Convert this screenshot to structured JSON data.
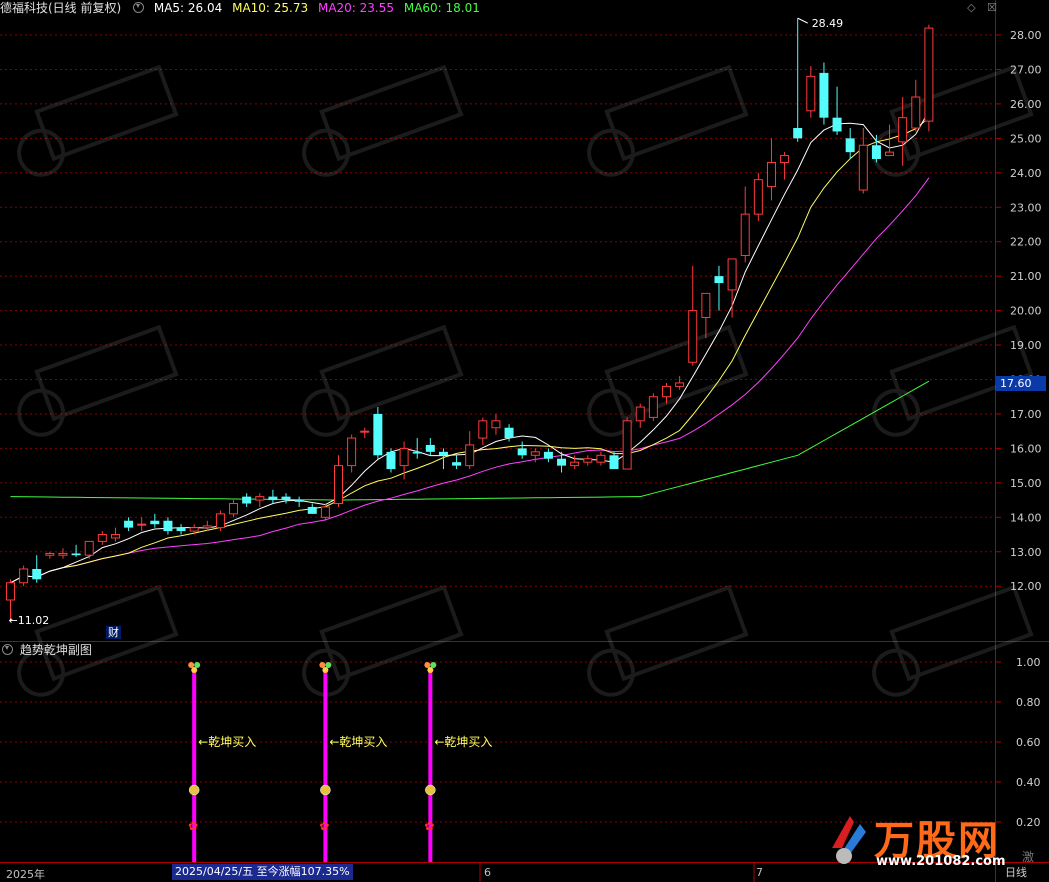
{
  "header": {
    "stock_name": "德福科技(日线 前复权)",
    "ma5_label": "MA5: 26.04",
    "ma10_label": "MA10: 25.73",
    "ma20_label": "MA20: 23.55",
    "ma60_label": "MA60: 18.01"
  },
  "subchart": {
    "title": "趋势乾坤副图",
    "signal_label": "←乾坤买入",
    "signal_bars": [
      {
        "index": 14,
        "value": 1.0
      },
      {
        "index": 24,
        "value": 1.0
      },
      {
        "index": 32,
        "value": 1.0
      }
    ]
  },
  "markers": {
    "finance": "财",
    "current_price": "17.60",
    "high_label": "28.49",
    "low_label": "11.02",
    "date_box": "2025/04/25/五  至今涨幅107.35%"
  },
  "time_axis": {
    "year": "2025年",
    "month_6": "6",
    "month_7": "7"
  },
  "logo": {
    "name": "万股网",
    "url": "www.201082.com",
    "period": "日线",
    "side_text": "激"
  },
  "colors": {
    "up": "#ff3a3a",
    "down": "#54fcfc",
    "ma5": "#ffffff",
    "ma10": "#ffff60",
    "ma20": "#ff40ff",
    "ma60": "#40ff40",
    "grid": "#8a0000",
    "signal": "#ff00ff"
  },
  "chart_data": {
    "type": "candlestick",
    "price_axis": {
      "ticks": [
        "28.00",
        "27.00",
        "26.00",
        "25.00",
        "24.00",
        "23.00",
        "22.00",
        "21.00",
        "20.00",
        "19.00",
        "18.00",
        "17.00",
        "16.00",
        "15.00",
        "14.00",
        "13.00",
        "12.00"
      ],
      "ylim": [
        11.0,
        28.5
      ]
    },
    "sub_axis": {
      "ticks": [
        "1.00",
        "0.80",
        "0.60",
        "0.40",
        "0.20"
      ],
      "ylim": [
        0.0,
        1.0
      ]
    },
    "candles": [
      {
        "o": 11.6,
        "h": 12.2,
        "l": 11.02,
        "c": 12.1
      },
      {
        "o": 12.1,
        "h": 12.6,
        "l": 12.0,
        "c": 12.5
      },
      {
        "o": 12.5,
        "h": 12.9,
        "l": 12.1,
        "c": 12.2
      },
      {
        "o": 12.9,
        "h": 13.0,
        "l": 12.8,
        "c": 12.95
      },
      {
        "o": 12.9,
        "h": 13.1,
        "l": 12.8,
        "c": 12.95
      },
      {
        "o": 12.95,
        "h": 13.2,
        "l": 12.85,
        "c": 12.9
      },
      {
        "o": 12.9,
        "h": 13.3,
        "l": 12.8,
        "c": 13.3
      },
      {
        "o": 13.3,
        "h": 13.6,
        "l": 13.2,
        "c": 13.5
      },
      {
        "o": 13.4,
        "h": 13.7,
        "l": 13.3,
        "c": 13.5
      },
      {
        "o": 13.9,
        "h": 14.0,
        "l": 13.6,
        "c": 13.7
      },
      {
        "o": 13.8,
        "h": 14.0,
        "l": 13.6,
        "c": 13.8
      },
      {
        "o": 13.9,
        "h": 14.1,
        "l": 13.7,
        "c": 13.8
      },
      {
        "o": 13.9,
        "h": 14.0,
        "l": 13.5,
        "c": 13.6
      },
      {
        "o": 13.7,
        "h": 13.8,
        "l": 13.5,
        "c": 13.6
      },
      {
        "o": 13.6,
        "h": 13.8,
        "l": 13.5,
        "c": 13.7
      },
      {
        "o": 13.7,
        "h": 13.9,
        "l": 13.6,
        "c": 13.75
      },
      {
        "o": 13.7,
        "h": 14.2,
        "l": 13.6,
        "c": 14.1
      },
      {
        "o": 14.1,
        "h": 14.5,
        "l": 14.0,
        "c": 14.4
      },
      {
        "o": 14.6,
        "h": 14.7,
        "l": 14.3,
        "c": 14.4
      },
      {
        "o": 14.5,
        "h": 14.7,
        "l": 14.3,
        "c": 14.6
      },
      {
        "o": 14.6,
        "h": 14.8,
        "l": 14.4,
        "c": 14.5
      },
      {
        "o": 14.6,
        "h": 14.7,
        "l": 14.4,
        "c": 14.5
      },
      {
        "o": 14.5,
        "h": 14.6,
        "l": 14.3,
        "c": 14.45
      },
      {
        "o": 14.3,
        "h": 14.4,
        "l": 14.1,
        "c": 14.1
      },
      {
        "o": 14.0,
        "h": 14.4,
        "l": 13.9,
        "c": 14.3
      },
      {
        "o": 14.4,
        "h": 15.8,
        "l": 14.3,
        "c": 15.5
      },
      {
        "o": 15.5,
        "h": 16.4,
        "l": 15.3,
        "c": 16.3
      },
      {
        "o": 16.5,
        "h": 16.6,
        "l": 16.3,
        "c": 16.5
      },
      {
        "o": 17.0,
        "h": 17.2,
        "l": 15.7,
        "c": 15.8
      },
      {
        "o": 15.9,
        "h": 16.0,
        "l": 15.3,
        "c": 15.4
      },
      {
        "o": 15.5,
        "h": 16.2,
        "l": 15.1,
        "c": 16.0
      },
      {
        "o": 15.9,
        "h": 16.3,
        "l": 15.7,
        "c": 15.85
      },
      {
        "o": 16.1,
        "h": 16.3,
        "l": 15.8,
        "c": 15.9
      },
      {
        "o": 15.9,
        "h": 16.0,
        "l": 15.4,
        "c": 15.8
      },
      {
        "o": 15.6,
        "h": 15.8,
        "l": 15.4,
        "c": 15.5
      },
      {
        "o": 15.5,
        "h": 16.5,
        "l": 15.4,
        "c": 16.1
      },
      {
        "o": 16.3,
        "h": 16.9,
        "l": 16.1,
        "c": 16.8
      },
      {
        "o": 16.6,
        "h": 17.0,
        "l": 16.4,
        "c": 16.8
      },
      {
        "o": 16.6,
        "h": 16.7,
        "l": 16.2,
        "c": 16.3
      },
      {
        "o": 16.0,
        "h": 16.2,
        "l": 15.7,
        "c": 15.8
      },
      {
        "o": 15.8,
        "h": 16.0,
        "l": 15.6,
        "c": 15.9
      },
      {
        "o": 15.9,
        "h": 16.0,
        "l": 15.6,
        "c": 15.7
      },
      {
        "o": 15.7,
        "h": 15.9,
        "l": 15.3,
        "c": 15.5
      },
      {
        "o": 15.5,
        "h": 15.8,
        "l": 15.4,
        "c": 15.6
      },
      {
        "o": 15.6,
        "h": 15.8,
        "l": 15.5,
        "c": 15.7
      },
      {
        "o": 15.6,
        "h": 15.9,
        "l": 15.5,
        "c": 15.8
      },
      {
        "o": 15.8,
        "h": 15.9,
        "l": 15.4,
        "c": 15.4
      },
      {
        "o": 15.4,
        "h": 16.9,
        "l": 15.4,
        "c": 16.8
      },
      {
        "o": 16.8,
        "h": 17.3,
        "l": 16.6,
        "c": 17.2
      },
      {
        "o": 16.9,
        "h": 17.6,
        "l": 16.8,
        "c": 17.5
      },
      {
        "o": 17.5,
        "h": 17.9,
        "l": 17.3,
        "c": 17.8
      },
      {
        "o": 17.8,
        "h": 18.1,
        "l": 17.7,
        "c": 17.9
      },
      {
        "o": 18.5,
        "h": 21.3,
        "l": 18.4,
        "c": 20.0
      },
      {
        "o": 19.8,
        "h": 20.4,
        "l": 19.2,
        "c": 20.5
      },
      {
        "o": 21.0,
        "h": 21.3,
        "l": 20.0,
        "c": 20.8
      },
      {
        "o": 20.6,
        "h": 21.4,
        "l": 19.8,
        "c": 21.5
      },
      {
        "o": 21.6,
        "h": 23.6,
        "l": 21.4,
        "c": 22.8
      },
      {
        "o": 22.8,
        "h": 24.0,
        "l": 22.6,
        "c": 23.8
      },
      {
        "o": 23.6,
        "h": 25.0,
        "l": 23.2,
        "c": 24.3
      },
      {
        "o": 24.3,
        "h": 24.6,
        "l": 23.8,
        "c": 24.5
      },
      {
        "o": 25.3,
        "h": 28.49,
        "l": 24.9,
        "c": 25.0
      },
      {
        "o": 25.8,
        "h": 27.1,
        "l": 25.6,
        "c": 26.8
      },
      {
        "o": 26.9,
        "h": 27.2,
        "l": 25.4,
        "c": 25.6
      },
      {
        "o": 25.6,
        "h": 26.5,
        "l": 25.1,
        "c": 25.2
      },
      {
        "o": 25.0,
        "h": 25.3,
        "l": 24.4,
        "c": 24.6
      },
      {
        "o": 23.5,
        "h": 25.3,
        "l": 23.4,
        "c": 24.8
      },
      {
        "o": 24.8,
        "h": 25.1,
        "l": 24.3,
        "c": 24.4
      },
      {
        "o": 24.5,
        "h": 25.4,
        "l": 24.5,
        "c": 24.6
      },
      {
        "o": 24.9,
        "h": 26.2,
        "l": 24.2,
        "c": 25.6
      },
      {
        "o": 25.3,
        "h": 26.7,
        "l": 25.2,
        "c": 26.2
      },
      {
        "o": 25.5,
        "h": 28.3,
        "l": 25.2,
        "c": 28.2
      }
    ],
    "ma60_anchor": [
      [
        0,
        14.6
      ],
      [
        25,
        14.5
      ],
      [
        48,
        14.6
      ],
      [
        60,
        15.8
      ],
      [
        70,
        17.95
      ]
    ]
  }
}
